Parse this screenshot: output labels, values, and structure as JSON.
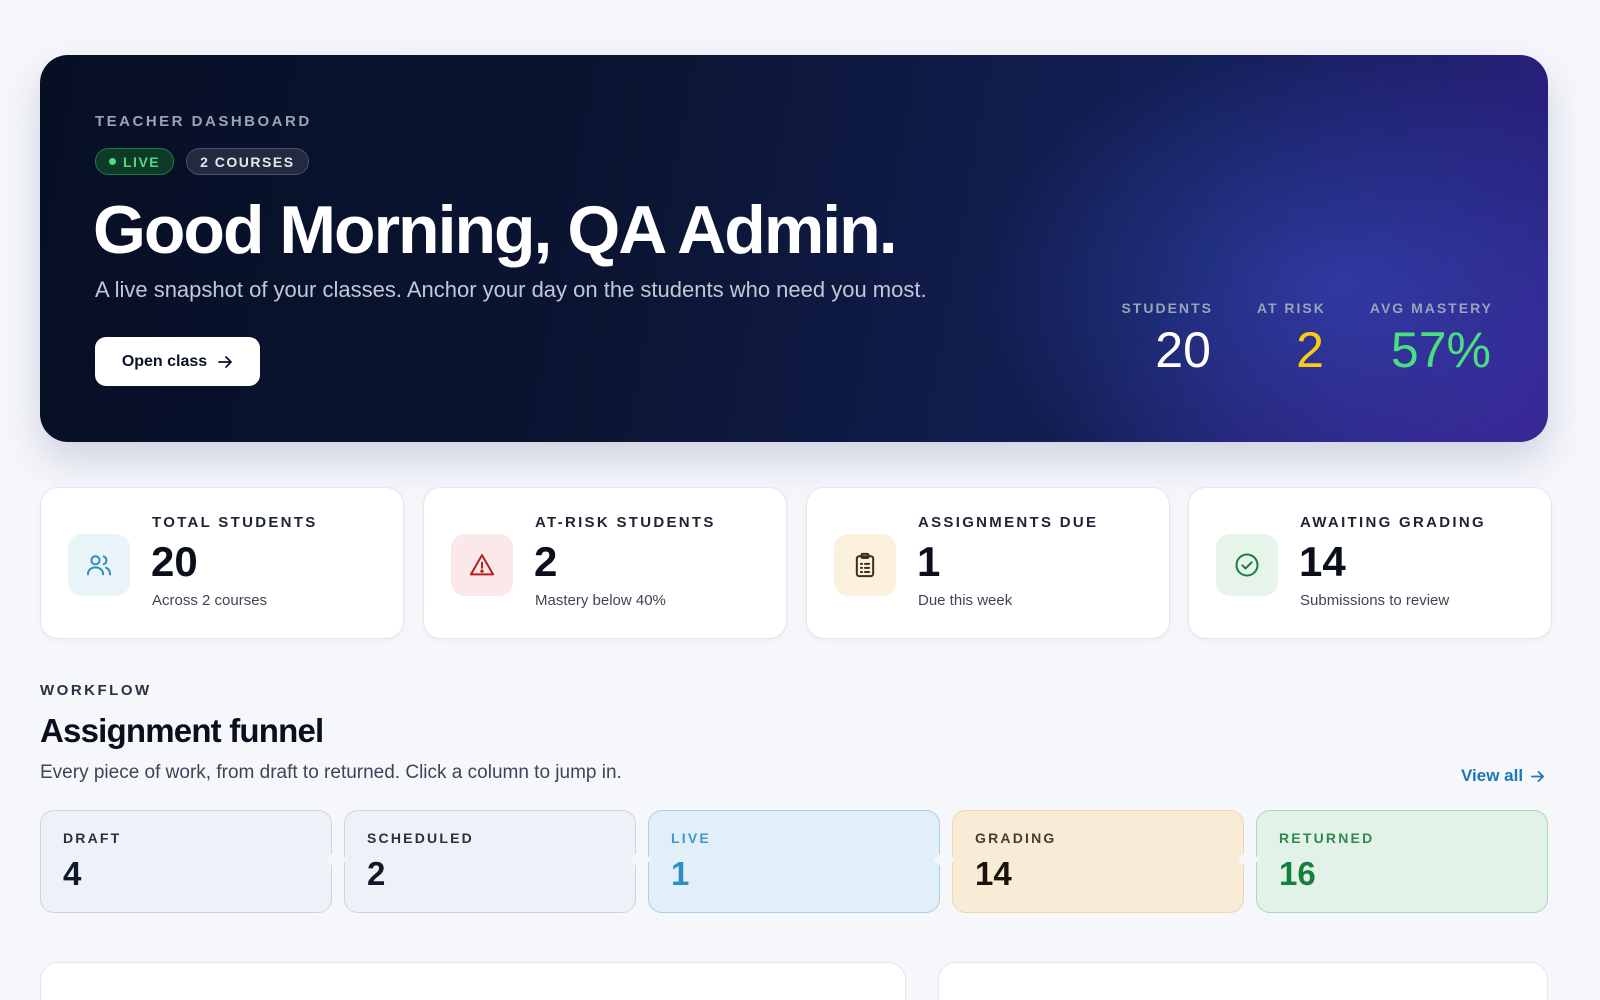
{
  "hero": {
    "eyebrow": "TEACHER DASHBOARD",
    "badges": {
      "live": "LIVE",
      "courses": "2 COURSES"
    },
    "title": "Good Morning, QA Admin.",
    "subtitle": "A live snapshot of your classes. Anchor your day on the students who need you most.",
    "button_label": "Open class",
    "stats": [
      {
        "label": "STUDENTS",
        "value": "20",
        "color": "#ffffff"
      },
      {
        "label": "AT RISK",
        "value": "2",
        "color": "#facc15"
      },
      {
        "label": "AVG MASTERY",
        "value": "57%",
        "color": "#4ade80"
      }
    ]
  },
  "stat_cards": [
    {
      "label": "TOTAL STUDENTS",
      "value": "20",
      "sub": "Across 2 courses",
      "icon": "users-icon",
      "icon_bg": "#e8f4f8",
      "icon_color": "#2b8fb8"
    },
    {
      "label": "AT-RISK STUDENTS",
      "value": "2",
      "sub": "Mastery below 40%",
      "icon": "warning-icon",
      "icon_bg": "#fbe8e8",
      "icon_color": "#b91c1c"
    },
    {
      "label": "ASSIGNMENTS DUE",
      "value": "1",
      "sub": "Due this week",
      "icon": "clipboard-icon",
      "icon_bg": "#fbf1dc",
      "icon_color": "#3a2f1a"
    },
    {
      "label": "AWAITING GRADING",
      "value": "14",
      "sub": "Submissions to review",
      "icon": "check-circle-icon",
      "icon_bg": "#e6f4ea",
      "icon_color": "#15803d"
    }
  ],
  "workflow": {
    "eyebrow": "WORKFLOW",
    "title": "Assignment funnel",
    "subtitle": "Every piece of work, from draft to returned. Click a column to jump in.",
    "view_all": "View all",
    "stages": [
      {
        "label": "DRAFT",
        "value": "4",
        "bg": "#eef1f7",
        "border": "#cdd3e0",
        "label_color": "#2b3040",
        "value_color": "#111827"
      },
      {
        "label": "SCHEDULED",
        "value": "2",
        "bg": "#eef1f7",
        "border": "#cdd3e0",
        "label_color": "#2b3040",
        "value_color": "#111827"
      },
      {
        "label": "LIVE",
        "value": "1",
        "bg": "#e2eef8",
        "border": "#a9cfe6",
        "label_color": "#3b9bc9",
        "value_color": "#2b8fc4"
      },
      {
        "label": "GRADING",
        "value": "14",
        "bg": "#f8ecd6",
        "border": "#eed6a8",
        "label_color": "#4a3d24",
        "value_color": "#1a1408"
      },
      {
        "label": "RETURNED",
        "value": "16",
        "bg": "#e3f2e8",
        "border": "#a8d8b6",
        "label_color": "#2f8a4f",
        "value_color": "#15803d"
      }
    ]
  }
}
